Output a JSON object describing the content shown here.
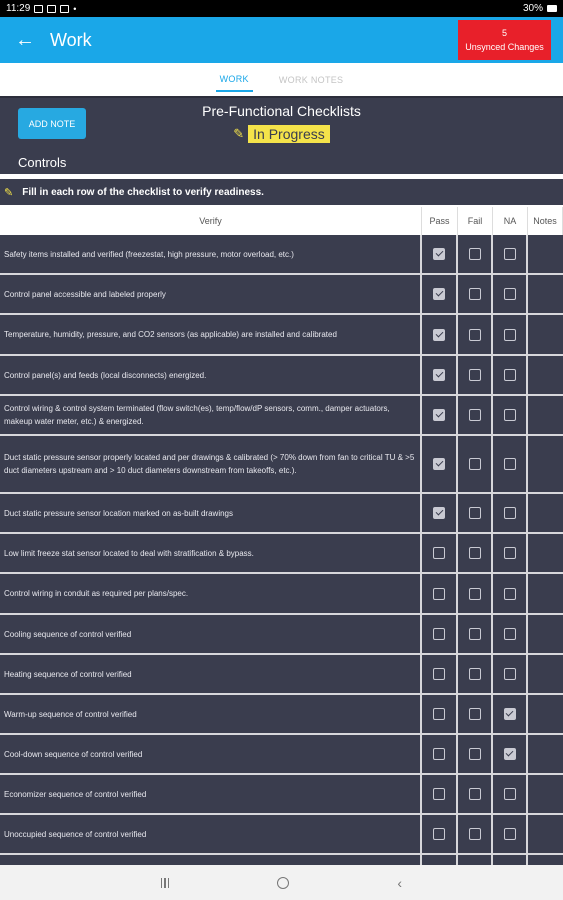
{
  "status_bar": {
    "time": "11:29",
    "battery": "30%"
  },
  "app_bar": {
    "title": "Work",
    "unsynced_count": "5",
    "unsynced_label": "Unsynced Changes"
  },
  "tabs": [
    {
      "label": "WORK",
      "active": true
    },
    {
      "label": "WORK NOTES",
      "active": false
    }
  ],
  "header": {
    "add_note_label": "ADD NOTE",
    "checklist_title": "Pre-Functional Checklists",
    "status": "In Progress",
    "section": "Controls"
  },
  "instruction": "Fill in each row of the checklist to verify readiness.",
  "table": {
    "columns": {
      "verify": "Verify",
      "pass": "Pass",
      "fail": "Fail",
      "na": "NA",
      "notes": "Notes"
    },
    "rows": [
      {
        "text": "Safety items installed and verified (freezestat, high pressure, motor overload, etc.)",
        "pass": true,
        "fail": false,
        "na": false,
        "h": 40
      },
      {
        "text": "Control panel accessible and labeled properly",
        "pass": true,
        "fail": false,
        "na": false,
        "h": 40
      },
      {
        "text": "Temperature, humidity, pressure, and CO2 sensors (as applicable) are installed and calibrated",
        "pass": true,
        "fail": false,
        "na": false,
        "h": 41
      },
      {
        "text": "Control panel(s) and feeds (local disconnects) energized.",
        "pass": true,
        "fail": false,
        "na": false,
        "h": 40
      },
      {
        "text": "Control wiring & control system terminated (flow switch(es), temp/flow/dP sensors, comm., damper actuators, makeup water meter, etc.) & energized.",
        "pass": true,
        "fail": false,
        "na": false,
        "h": 40
      },
      {
        "text": "Duct static pressure sensor properly located and per drawings & calibrated (> 70% down from fan to critical TU & >5 duct diameters upstream and > 10 duct diameters downstream from takeoffs, etc.).",
        "pass": true,
        "fail": false,
        "na": false,
        "h": 58
      },
      {
        "text": "Duct static pressure sensor location marked on as-built drawings",
        "pass": true,
        "fail": false,
        "na": false,
        "h": 40
      },
      {
        "text": "Low limit freeze stat sensor located to deal with stratification & bypass.",
        "pass": false,
        "fail": false,
        "na": false,
        "h": 40
      },
      {
        "text": "Control wiring in conduit as required per plans/spec.",
        "pass": false,
        "fail": false,
        "na": false,
        "h": 41
      },
      {
        "text": "Cooling sequence of control verified",
        "pass": false,
        "fail": false,
        "na": false,
        "h": 40
      },
      {
        "text": "Heating sequence of control verified",
        "pass": false,
        "fail": false,
        "na": false,
        "h": 40
      },
      {
        "text": "Warm-up sequence of control verified",
        "pass": false,
        "fail": false,
        "na": true,
        "h": 40
      },
      {
        "text": "Cool-down sequence of control verified",
        "pass": false,
        "fail": false,
        "na": true,
        "h": 40
      },
      {
        "text": "Economizer sequence of control verified",
        "pass": false,
        "fail": false,
        "na": false,
        "h": 40
      },
      {
        "text": "Unoccupied sequence of control verified",
        "pass": false,
        "fail": false,
        "na": false,
        "h": 40
      },
      {
        "text": "",
        "pass": false,
        "fail": false,
        "na": false,
        "h": 40
      }
    ]
  },
  "colors": {
    "accent": "#1aa7e8",
    "unsynced": "#e8202a",
    "panel": "#3a3d4e",
    "status_badge": "#f4e34a"
  }
}
